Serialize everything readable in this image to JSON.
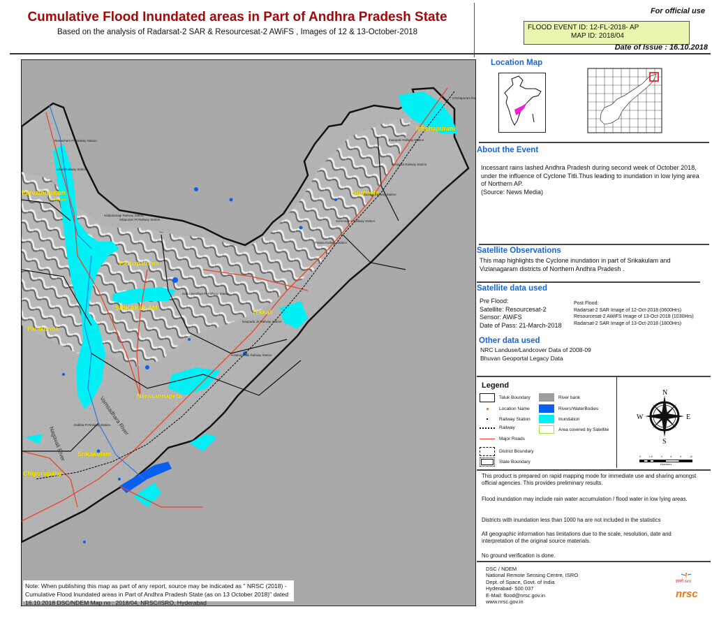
{
  "header": {
    "title": "Cumulative Flood Inundated areas in Part of Andhra Pradesh State",
    "subtitle": "Based on the analysis of Radarsat-2 SAR & Resourcesat-2 AWiFS ,  Images of 12 & 13-October-2018",
    "official_use": "For official use",
    "flood_event_id": "FLOOD EVENT ID: 12-FL-2018- AP",
    "map_id": "MAP ID: 2018/04",
    "date_of_issue": "Date of Issue : 16.10.2018"
  },
  "map": {
    "place_labels": {
      "ichchapuram": "Ichchapuram",
      "parvathipuram": "Parvathipuram",
      "sompeta": "Sompeta",
      "pathapatnam": "Pathapatnam",
      "srikakulam_district": "SRIKAKULAM",
      "tekkali": "Tekkali",
      "palakonda": "Palakonda",
      "narasannapeta": "Narasannapeta",
      "srikakulam": "Srikakulam",
      "chipurupalle": "Chipurupalle",
      "kasibugga": "Kasibugga"
    },
    "railway_stations": [
      "Ramachem Pt Railway Station",
      "Lihuri Railway Station",
      "Hatipatanagi Railway Station",
      "Sitapuram Pt Railway Station",
      "Jhaiapaki Railway Station",
      "Sompeta Railway Station",
      "Baruva Railway Station",
      "Summadevi Railway Station",
      "Palasa Railway Station",
      "Naupada Jn Railway Station",
      "Kotabommali Railway Station",
      "Dudu Sendhya Pt Railway Station",
      "Dabbla Pt Railway Station",
      "Ichchapuram Railway Station"
    ],
    "river_labels": {
      "vamsadhara": "Vamsadhara River",
      "nagavali": "Nagavali River"
    },
    "note": "Note: When publishing this map as part of any report, source may be indicated as \" NRSC (2018) - Cumulative  Flood Inundated areas in Part of Andhra Pradesh State (as on 13 October 2018)\" dated 16.10.2018 DSC/NDEM Map no : 2018/04, NRSC/ISRO, Hyderabad"
  },
  "panel": {
    "location_map": "Location Map",
    "about_event": {
      "heading": "About the Event",
      "text": "Incessant rains lashed Andhra Pradesh during second week of October 2018, under the influence of Cyclone Titli.Thus leading to inundation in low lying area of Northern AP.",
      "source": "(Source: News Media)"
    },
    "satellite_observations": {
      "heading": "Satellite Observations",
      "text": "This map highlights the Cyclone inundation in part of Srikakulam and Vizianagaram districts of Northern Andhra Pradesh ."
    },
    "satellite_data": {
      "heading": "Satellite data used",
      "pre_flood": [
        "Pre Flood:",
        "Satellite: Resourcesat-2",
        "Sensor: AWiFS",
        "Date of Pass: 21-March-2018"
      ],
      "post_flood": [
        "Post Flood:",
        "Radarsat-2 SAR Image of 12-Oct-2018 (0600Hrs)",
        "Resourcesat-2 AWiFS Image of 13-Oct-2018 (1030Hrs)",
        "Radarsat-2 SAR Image of 13-Oct-2018 (1800Hrs)"
      ]
    },
    "other_data": {
      "heading": "Other data used",
      "items": [
        "NRC Landuse/Landcover Data of 2008-09",
        "Bhuvan Geoportal Legacy Data"
      ]
    },
    "legend": {
      "title": "Legend",
      "left": [
        "Taluk Boundary",
        "Location Name",
        "Railway Station",
        "Railway",
        "Major Roads",
        "District Boundary",
        "State Boundary"
      ],
      "right": [
        "River bank",
        "Rivers/WaterBodies",
        "Inundation",
        "Area covered by Satellite"
      ],
      "colors": {
        "river_bank": "#9e9e9e",
        "water": "#0a5ff0",
        "inundation": "#00f0f5",
        "satellite_area": "#a6e03a",
        "roads": "#e8442a",
        "location": "#f07d1a"
      }
    },
    "compass": {
      "n": "N",
      "s": "S",
      "e": "E",
      "w": "W"
    },
    "scale": {
      "ticks": [
        "0",
        "1.5",
        "3",
        "6",
        "9",
        "12"
      ],
      "unit": "Kilometers"
    },
    "disclaimers": [
      "This product is prepared on rapid mapping mode for immediate use and sharing amongst official agencies. This provides preliminary results.",
      "Flood inundation may include rain water accumulation / flood water in low lying areas.",
      "Districts with inundation less than 1000 ha are not included in the statistics",
      "All geographic information has limitations due to the scale, resolution, date and interpretation of the original source materials.",
      "No ground verification is done."
    ],
    "contact": [
      "DSC / NDEM",
      "National Remote Sensing Centre, ISRO",
      "Dept. of Space, Govt. of India",
      "Hyderabad- 500 037",
      "E-Mail: flood@nrsc.gov.in",
      "www.nrsc.gov.in"
    ],
    "logo_text": "nrsc",
    "isro_text": "इसरो  isro"
  }
}
